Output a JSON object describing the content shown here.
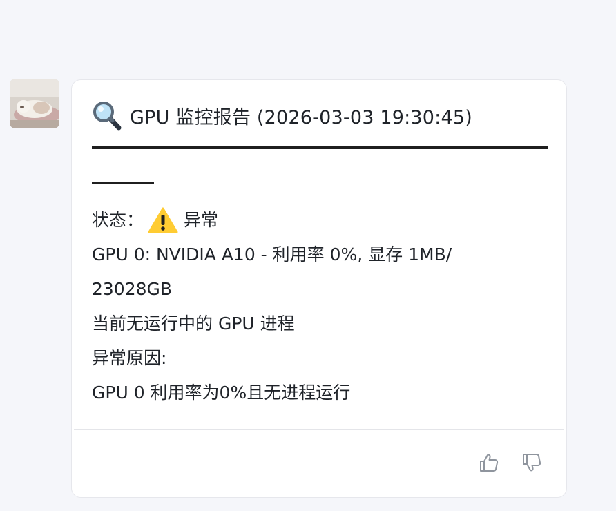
{
  "message": {
    "title": "GPU 监控报告 (2026-03-03 19:30:45)",
    "status_label": "状态：",
    "status_value": "异常",
    "gpu_line_1": "GPU 0: NVIDIA A10 - 利用率 0%, 显存 1MB/",
    "gpu_line_2": "23028GB",
    "process_line": "当前无运行中的 GPU 进程",
    "reason_label": "异常原因:",
    "reason_text": "GPU 0 利用率为0%且无进程运行"
  },
  "icons": {
    "title_icon": "magnifier-icon",
    "status_icon": "warning-icon",
    "like": "thumbs-up-icon",
    "dislike": "thumbs-down-icon"
  },
  "colors": {
    "page_bg": "#f5f6fa",
    "card_bg": "#ffffff",
    "text": "#1f2329",
    "warning": "#ffcc33",
    "icon_gray": "#8f959e"
  }
}
